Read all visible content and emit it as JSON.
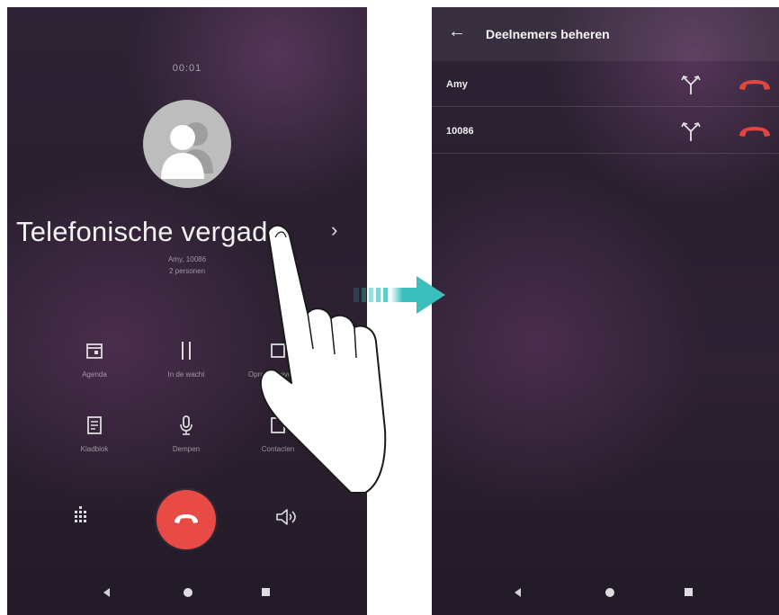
{
  "left_screen": {
    "time": "00:01",
    "call_title": "Telefonische vergad...",
    "participants": "Amy, 10086",
    "participant_count": "2 personen",
    "actions": [
      {
        "icon": "calendar-icon",
        "label": "Agenda"
      },
      {
        "icon": "pause-icon",
        "label": "In de wacht"
      },
      {
        "icon": "add-call-icon",
        "label": "Oproep toevoegen"
      },
      {
        "icon": "notes-icon",
        "label": "Kladblok"
      },
      {
        "icon": "microphone-icon",
        "label": "Dempen"
      },
      {
        "icon": "contacts-icon",
        "label": "Contacten"
      }
    ],
    "bottom_controls": [
      "dialpad-icon",
      "end-call-icon",
      "speaker-icon"
    ]
  },
  "right_screen": {
    "title": "Deelnemers beheren",
    "participants": [
      {
        "name": "Amy"
      },
      {
        "name": "10086"
      }
    ]
  },
  "colors": {
    "end_call": "#e84a45",
    "arrow": "#3bbfbd",
    "hangup_icon": "#e0473e"
  }
}
